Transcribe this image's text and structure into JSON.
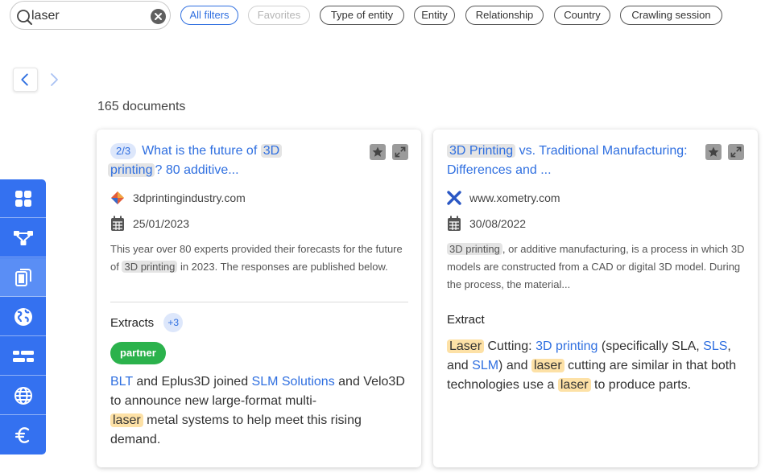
{
  "search": {
    "value": "laser",
    "placeholder": "Search"
  },
  "filters": [
    {
      "label": "All filters",
      "state": "active"
    },
    {
      "label": "Favorites",
      "state": "disabled"
    },
    {
      "label": "Type of entity",
      "state": "normal"
    },
    {
      "label": "Entity",
      "state": "normal"
    },
    {
      "label": "Relationship",
      "state": "normal"
    },
    {
      "label": "Country",
      "state": "normal"
    },
    {
      "label": "Crawling session",
      "state": "normal"
    }
  ],
  "results": {
    "count_label": "165 documents"
  },
  "sidebar": {
    "items": [
      {
        "icon": "grid-icon"
      },
      {
        "icon": "network-icon"
      },
      {
        "icon": "documents-icon",
        "active": true
      },
      {
        "icon": "globe-americas-icon"
      },
      {
        "icon": "tags-icon"
      },
      {
        "icon": "globe-grid-icon"
      },
      {
        "icon": "euro-icon"
      }
    ]
  },
  "cards": [
    {
      "page_badge": "2/3",
      "title": {
        "pre": "What is the future of ",
        "hl1": "3D",
        "hl2": "printing",
        "post": "? 80 additive..."
      },
      "source": "3dprintingindustry.com",
      "date": "25/01/2023",
      "snippet": {
        "p1": "This year over 80 experts provided their forecasts for the future of ",
        "hl": "3D printing",
        "p2": " in 2023. The responses are published below."
      },
      "section_title": "Extracts",
      "extra_count": "+3",
      "tag": "partner",
      "extract": {
        "l1": "BLT",
        "t1": " and Eplus3D joined ",
        "l2": "SLM Solutions",
        "t2": " and Velo3D to announce new large-format multi-",
        "hl": "laser",
        "t3": " metal systems to help meet this rising demand."
      }
    },
    {
      "title": {
        "hl": "3D Printing",
        "post": " vs. Traditional Manufacturing: Differences and ..."
      },
      "source": "www.xometry.com",
      "date": "30/08/2022",
      "snippet": {
        "hl": "3D printing",
        "p2": ", or additive manufacturing, is a process in which 3D models are constructed from a CAD or digital 3D model. During the process, the material..."
      },
      "section_title": "Extract",
      "extract": {
        "hl1": "Laser",
        "t1": " Cutting: ",
        "l1": "3D printing",
        "t2": " (specifically SLA, ",
        "l2": "SLS",
        "t3": ", and ",
        "l3": "SLM",
        "t4": ") and ",
        "hl2": "laser",
        "t5": " cutting are similar in that both technologies use a ",
        "hl3": "laser",
        "t6": " to produce parts."
      }
    }
  ],
  "colors": {
    "accent": "#3471f0",
    "link": "#2f6fe0",
    "tag": "#2bb24c",
    "highlight": "#fde1a6"
  }
}
